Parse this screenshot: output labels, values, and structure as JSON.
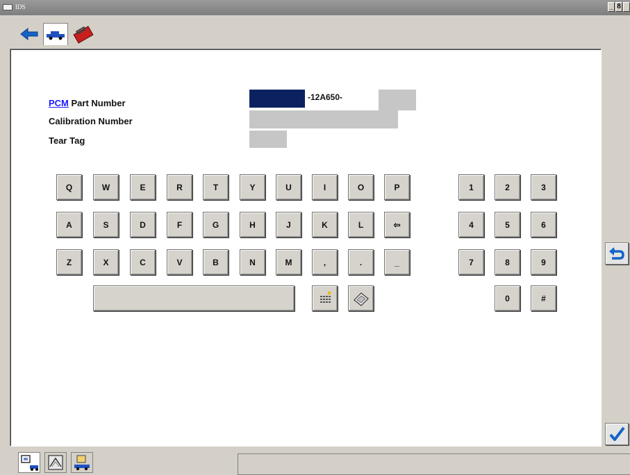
{
  "window": {
    "title": "IDS",
    "controls": [
      "_",
      "8"
    ]
  },
  "toolbar": {
    "tabs": [
      {
        "name": "back-arrow-icon"
      },
      {
        "name": "vehicle-icon"
      },
      {
        "name": "toolbox-icon"
      }
    ]
  },
  "form": {
    "pcm_link": "PCM",
    "part_number_label": " Part Number",
    "calibration_label": "Calibration Number",
    "tear_tag_label": "Tear Tag",
    "part_number_middle": "-12A650-"
  },
  "keyboard": {
    "row1": [
      "Q",
      "W",
      "E",
      "R",
      "T",
      "Y",
      "U",
      "I",
      "O",
      "P"
    ],
    "row2": [
      "A",
      "S",
      "D",
      "F",
      "G",
      "H",
      "J",
      "K",
      "L",
      "⇦"
    ],
    "row3": [
      "Z",
      "X",
      "C",
      "V",
      "B",
      "N",
      "M",
      ",",
      ".",
      "_"
    ],
    "numpad": [
      "1",
      "2",
      "3",
      "4",
      "5",
      "6",
      "7",
      "8",
      "9",
      "0",
      "#"
    ]
  },
  "side": {
    "return_icon": "return-arrow-icon",
    "confirm_icon": "checkmark-icon"
  },
  "bottom": {
    "tabs": [
      "session-info-icon",
      "network-icon",
      "vehicle-data-icon"
    ],
    "status": ""
  },
  "colors": {
    "accent": "#0c2260",
    "link": "#1a1aff",
    "field": "#c6c6c6",
    "icon_blue": "#1464c8"
  }
}
